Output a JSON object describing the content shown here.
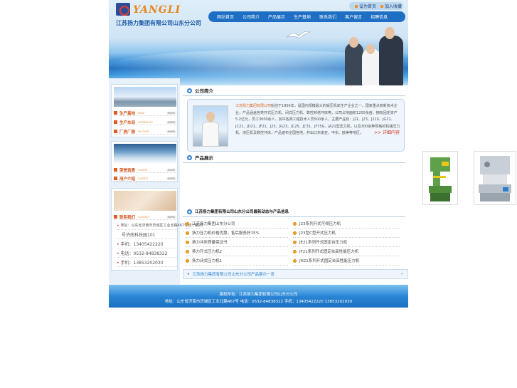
{
  "header": {
    "logo_word": "YANGLI",
    "company": "江苏扬力集团有限公司山东分公司",
    "toplinks": [
      "设为首页",
      "加入收藏"
    ],
    "nav": [
      "网站首页",
      "公司简介",
      "产品展示",
      "生产基地",
      "联系我们",
      "客户留言",
      "招聘信息"
    ]
  },
  "sidebar": {
    "block1": [
      {
        "label": "生产基地",
        "en": "BASE",
        "more": "MORE"
      },
      {
        "label": "生产车间",
        "en": "WORKSHOP",
        "more": "MORE"
      },
      {
        "label": "厂房厂貌",
        "en": "FACTORY",
        "more": "MORE"
      }
    ],
    "block2": [
      {
        "label": "荣誉资质",
        "en": "HONOR",
        "more": "MORE"
      },
      {
        "label": "用户介绍",
        "en": "CLIENTS",
        "more": "MORE"
      }
    ],
    "block3_title": {
      "label": "联系我们",
      "en": "CONTACT",
      "more": "MORE"
    },
    "contacts": [
      "地址：山东省济南市历城区工业北路467号经十路20",
      "号济南科技园101",
      "手机：13405422220",
      "电话：0532-84838322",
      "手机：13853202030"
    ]
  },
  "main": {
    "intro_title": "公司简介",
    "intro_highlight": "江苏扬力集团有限公司",
    "intro_text": "始创于1956年，是国内规模最大的锻压机床生产企业之一，国家重点高新技术企业，产品涵盖各类开式压力机、闭式压力机、数控转塔冲床等，公司占地面积1200余亩，拥有固定资产5.2亿元，员工3000余人，其中各类工程技术人员500余人。主要产品有：J21、J23、J21S、JG21、JC21、JD21、JF21、J23、JG23、JC25、JC31、JF75G、JA21型压力机，以及300余种规格的机械压力机、液压机及数控冲床，产品遍布全国各地，并出口东南亚、中东、欧美等地区。",
    "intro_more": ">> 详细内容",
    "products_title": "产品展示",
    "news_title": "江苏扬力集团有限公司山东分公司最新动态与产品信息",
    "left_col": [
      "江苏扬力集团山东分公司",
      "扬力压力机价格优惠，售后服务好15%",
      "扬力冲床质量保证书",
      "扬力开式压力机2",
      "扬力闭式压力机1"
    ],
    "right_col": [
      "J23系列开式可倾压力机",
      "J23型C型开式压力机",
      "JE21系列开式固定台压力机",
      "JF21系列开式固定台高性能压力机",
      "JH21系列开式固定台高性能压力机"
    ],
    "bottom_bar": "江苏扬力集团有限公司山东分公司产品展示一览",
    "bottom_end": "»"
  },
  "footer": {
    "line1": "版权所有：江苏扬力集团有限公司山东分公司",
    "line2": "地址：山东省济南市历城区工业北路467号 电话：0532-84838322 手机：13405422220 13853202030"
  }
}
